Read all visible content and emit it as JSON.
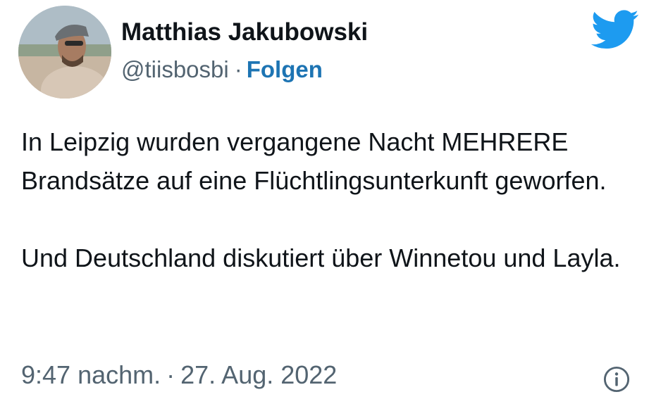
{
  "author": {
    "display_name": "Matthias Jakubowski",
    "handle": "@tiisbosbi",
    "separator": "·",
    "follow_label": "Folgen"
  },
  "tweet": {
    "paragraph_1": "In Leipzig wurden vergangene Nacht MEHRERE Brandsätze auf eine Flüchtlingsunterkunft geworfen.",
    "paragraph_2": "Und Deutschland diskutiert über Winnetou und Layla."
  },
  "meta": {
    "time": "9:47 nachm.",
    "separator": "·",
    "date": "27. Aug. 2022"
  },
  "icons": {
    "brand": "twitter-bird-icon",
    "info": "info-icon"
  },
  "colors": {
    "twitter_blue": "#1d9bf0",
    "follow_link": "#1d74b3",
    "secondary_text": "#536471",
    "primary_text": "#0f1419"
  }
}
